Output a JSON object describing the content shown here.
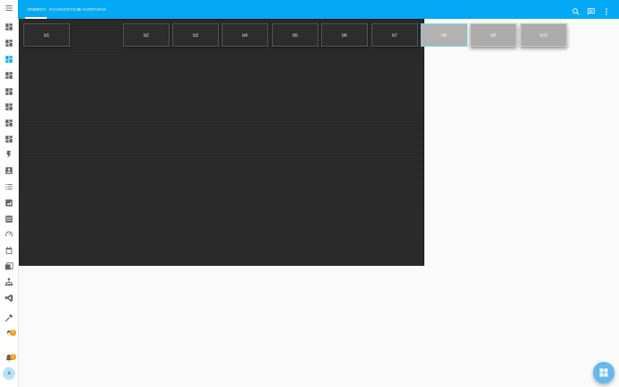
{
  "tabs": [
    {
      "label": "ENERGY",
      "active": true
    },
    {
      "label": "DIAGNOSTICS",
      "active": false
    },
    {
      "label": "B-OVERVIEW",
      "active": false
    }
  ],
  "buttons": [
    "b1",
    "b2",
    "b3",
    "b4",
    "b5",
    "b6",
    "b7",
    "b8",
    "b9",
    "b10"
  ],
  "badges": {
    "settings": "1",
    "notifications": "1"
  },
  "user": {
    "initial": "a"
  },
  "colors": {
    "primary": "#03a9f4",
    "badge": "#ff9800",
    "fab": "#64b8ec"
  },
  "sidebar_icons": [
    "menu-icon",
    "dashboard-icon",
    "dashboard-icon",
    "dashboard-icon",
    "dashboard-icon",
    "dashboard-icon",
    "dashboard-icon",
    "dashboard-icon",
    "dashboard-icon",
    "flash-icon",
    "account-box-icon",
    "list-icon",
    "chart-icon",
    "table-icon",
    "speedometer-icon",
    "calendar-icon",
    "media-icon",
    "hierarchy-icon",
    "vscode-icon",
    "hammer-icon",
    "settings-icon",
    "bell-icon"
  ]
}
